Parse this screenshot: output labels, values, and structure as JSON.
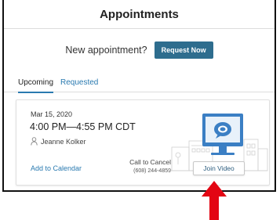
{
  "header": {
    "title": "Appointments"
  },
  "new_appointment": {
    "prompt": "New appointment?",
    "button_label": "Request Now"
  },
  "tabs": [
    {
      "label": "Upcoming",
      "active": true
    },
    {
      "label": "Requested",
      "active": false
    }
  ],
  "appointment": {
    "date": "Mar 15, 2020",
    "time": "4:00 PM—4:55 PM CDT",
    "provider": "Jeanne Kolker",
    "add_to_calendar": "Add to Calendar",
    "cancel_label": "Call to Cancel",
    "cancel_phone": "(608) 244-4859",
    "join_button": "Join Video"
  },
  "icons": [
    "person-icon",
    "computer-chat-illustration",
    "red-arrow-up-icon"
  ],
  "colors": {
    "primary_button": "#2e6d8e",
    "link": "#2a7ab0",
    "arrow": "#e30613",
    "monitor": "#3b7fc4"
  }
}
